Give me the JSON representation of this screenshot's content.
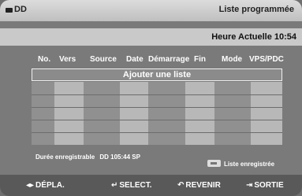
{
  "title_bar": {
    "disc_label": "DD",
    "screen_title": "Liste programmée"
  },
  "clock_bar": {
    "current_time": "Heure Actuelle 10:54"
  },
  "table": {
    "headers": [
      "No.",
      "Vers",
      "Source",
      "Date",
      "Démarrage",
      "Fin",
      "Mode",
      "VPS/PDC"
    ],
    "add_button_label": "Ajouter une liste",
    "rows": []
  },
  "status": {
    "duration_label": "Durée enregistrable",
    "duration_value": "DD 105:44 SP",
    "recorded_list_label": "Liste enregistrée"
  },
  "footer": {
    "move_label": "DÉPLA.",
    "select_label": "SELECT.",
    "back_label": "REVENIR",
    "exit_label": "SORTIE"
  },
  "icons": {
    "move": "left-right-arrows-icon",
    "select": "enter-icon",
    "back": "return-icon",
    "exit": "exit-icon",
    "disc": "disc-drive-icon",
    "recorded": "recorded-list-icon"
  }
}
